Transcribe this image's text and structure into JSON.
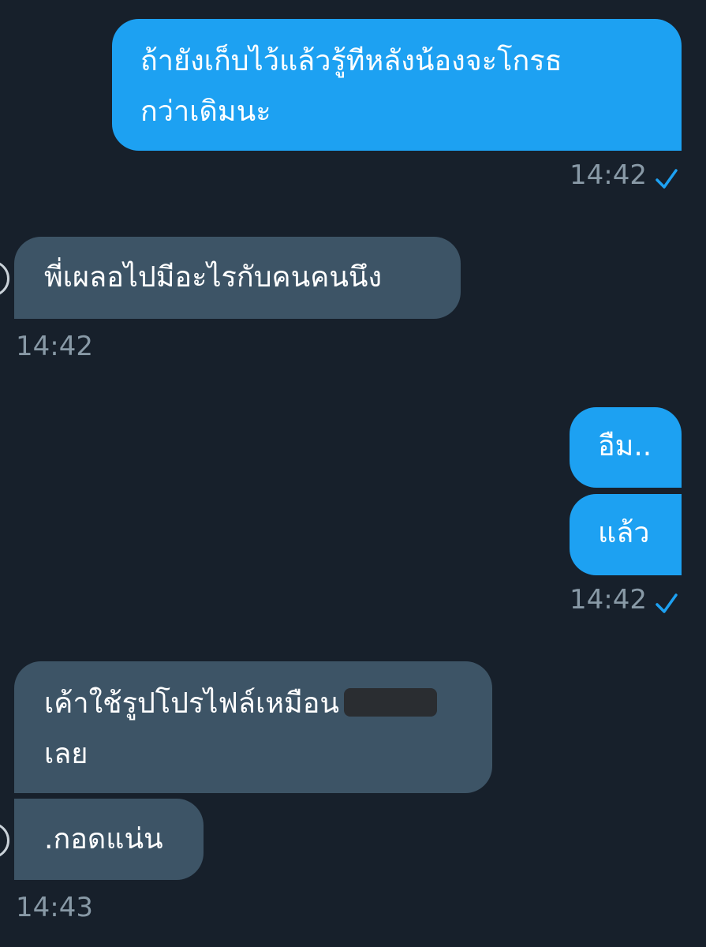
{
  "messages": [
    {
      "direction": "outgoing",
      "text": "ถ้ายังเก็บไว้แล้วรู้ทีหลังน้องจะโกรธ\nกว่าเดิมนะ"
    },
    {
      "direction": "incoming",
      "text": "พี่เผลอไปมีอะไรกับคนคนนึง"
    },
    {
      "direction": "outgoing",
      "text": "อืม.."
    },
    {
      "direction": "outgoing",
      "text": "แล้ว"
    },
    {
      "direction": "incoming",
      "text_line1": "เค้าใช้รูปโปรไฟล์เหมือน",
      "text_line2": "เลย",
      "redacted": true
    },
    {
      "direction": "incoming",
      "text": ".กอดแน่น"
    }
  ],
  "timestamps": {
    "t1": "14:42",
    "t2": "14:42",
    "t3": "14:42",
    "t4": "14:43"
  },
  "colors": {
    "background": "#17202b",
    "outgoing_bubble": "#1da1f2",
    "incoming_bubble": "#3d5466",
    "timestamp": "#8899a6",
    "read_check": "#1da1f2"
  },
  "icons": {
    "read_receipt": "checkmark-icon"
  }
}
